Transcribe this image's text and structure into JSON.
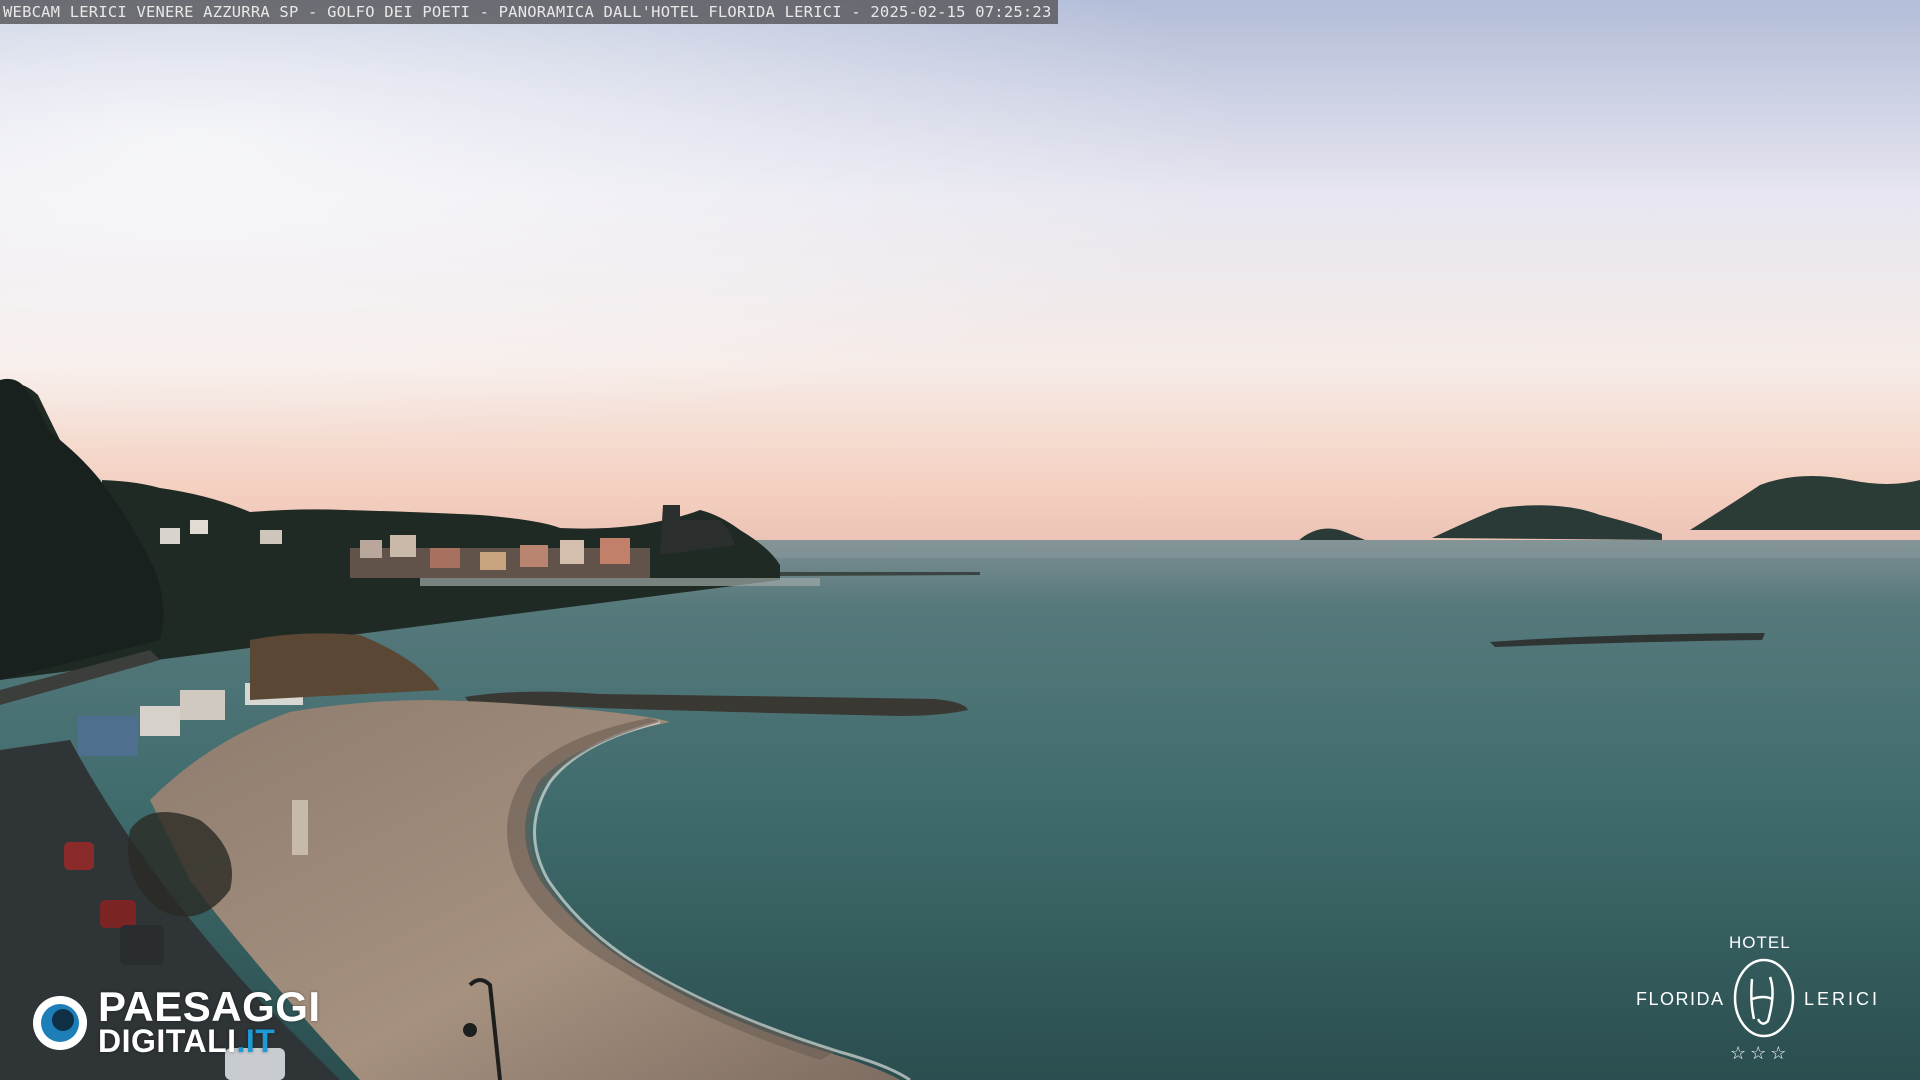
{
  "caption": "WEBCAM LERICI VENERE AZZURRA SP - GOLFO DEI POETI - PANORAMICA DALL'HOTEL FLORIDA LERICI - 2025-02-15 07:25:23",
  "watermark_left": {
    "line1": "PAESAGGI",
    "line2_main": "DIGITALI",
    "line2_suffix": ".IT",
    "icon": "eye-icon"
  },
  "watermark_right": {
    "hotel": "HOTEL",
    "left_word": "FLORIDA",
    "right_word": "LERICI",
    "monogram": "HF",
    "stars": "☆☆☆",
    "icon": "hotel-monogram-logo"
  },
  "colors": {
    "sky_top": "#b9c3dd",
    "sky_mid": "#f3ecef",
    "horizon_glow": "#f3c9b3",
    "sea": "#3d6a6c",
    "sea_dark": "#2a4a4c",
    "sand": "#a08e7c",
    "hills": "#1f2a24",
    "accent_blue": "#1e9ad6"
  }
}
